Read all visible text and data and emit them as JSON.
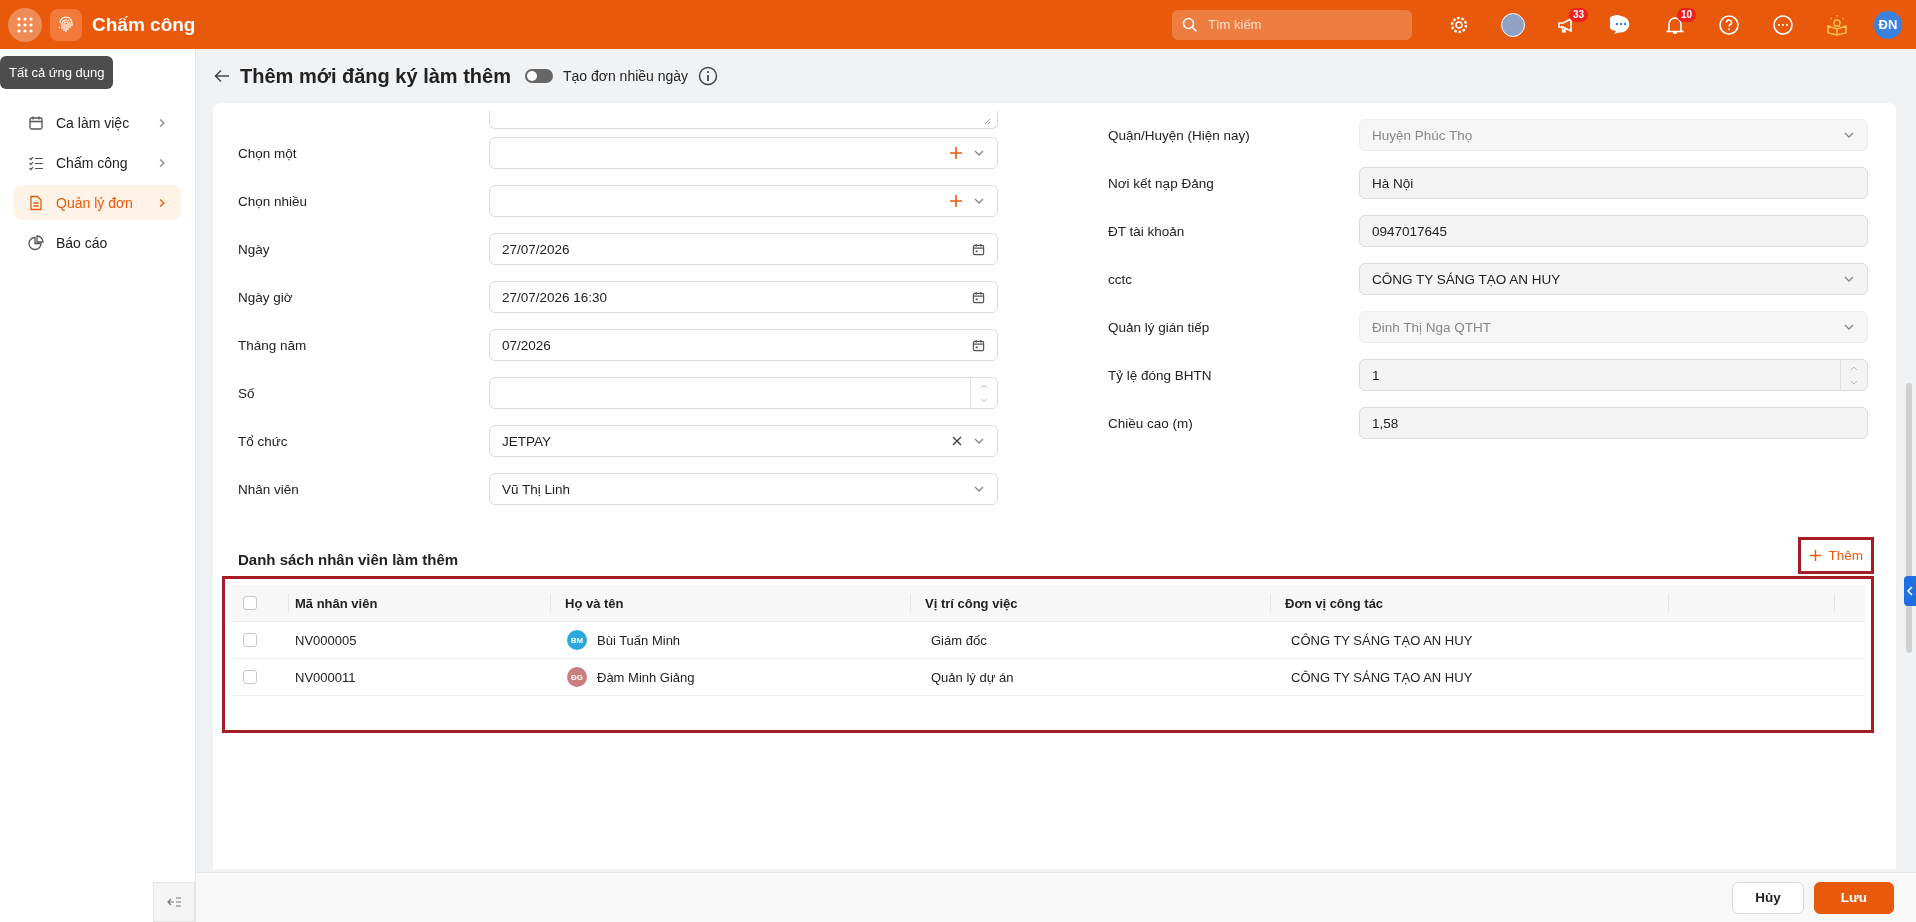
{
  "topbar": {
    "app_title": "Chấm công",
    "search": {
      "placeholder": "Tìm kiếm"
    },
    "badges": [
      {
        "kind": "megaphone",
        "count": "33"
      },
      {
        "kind": "bell",
        "count": "10"
      }
    ],
    "user_initials": "ĐN"
  },
  "tooltip": "Tất cả ứng dụng",
  "sidebar": {
    "items": [
      {
        "label": "Ca làm việc",
        "kind": "calendar",
        "selected": false,
        "has_children": true
      },
      {
        "label": "Chấm công",
        "kind": "checklist",
        "selected": false,
        "has_children": true
      },
      {
        "label": "Quản lý đơn",
        "kind": "document",
        "selected": true,
        "has_children": true
      },
      {
        "label": "Báo cáo",
        "kind": "pie",
        "selected": false,
        "has_children": false
      }
    ]
  },
  "header": {
    "title": "Thêm mới đăng ký làm thêm",
    "toggle": {
      "label": "Tạo đơn nhiều ngày",
      "on": false
    }
  },
  "form_left": [
    {
      "label": "Chọn một",
      "kind": "select-add"
    },
    {
      "label": "Chọn nhiều",
      "kind": "select-add"
    },
    {
      "label": "Ngày",
      "kind": "date",
      "value": "27/07/2026"
    },
    {
      "label": "Ngày giờ",
      "kind": "date",
      "value": "27/07/2026 16:30"
    },
    {
      "label": "Tháng năm",
      "kind": "date",
      "value": "07/2026"
    },
    {
      "label": "Số",
      "kind": "number"
    },
    {
      "label": "Tổ chức",
      "kind": "select-clear",
      "value": "JETPAY"
    },
    {
      "label": "Nhân viên",
      "kind": "select",
      "value": "Vũ Thị Linh"
    }
  ],
  "form_right": [
    {
      "label": "Quận/Huyện (Hiện nay)",
      "kind": "select",
      "value": "Huyện Phúc Thọ",
      "disabled": true
    },
    {
      "label": "Nơi kết nạp Đảng",
      "kind": "text",
      "value": "Hà Nội",
      "disabled": false
    },
    {
      "label": "ĐT tài khoản",
      "kind": "text",
      "value": "0947017645",
      "disabled": false
    },
    {
      "label": "cctc",
      "kind": "select",
      "value": "CÔNG TY SÁNG TẠO AN HUY",
      "disabled": false
    },
    {
      "label": "Quản lý gián tiếp",
      "kind": "select",
      "value": "Đinh Thị Nga QTHT",
      "disabled": true
    },
    {
      "label": "Tỷ lệ đóng BHTN",
      "kind": "number",
      "value": "1",
      "disabled": false
    },
    {
      "label": "Chiều cao (m)",
      "kind": "text",
      "value": "1,58",
      "disabled": false
    }
  ],
  "section": {
    "title": "Danh sách nhân viên làm thêm",
    "add_button": "Thêm"
  },
  "table": {
    "header_checked": false,
    "columns": [
      "Mã nhân viên",
      "Họ và tên",
      "Vị trí công việc",
      "Đơn vị công tác"
    ],
    "rows": [
      {
        "checked": false,
        "code": "NV000005",
        "initials": "BM",
        "color": "#29a8e0",
        "name": "Bùi Tuấn Minh",
        "position": "Giám đốc",
        "unit": "CÔNG TY SÁNG TẠO AN HUY"
      },
      {
        "checked": false,
        "code": "NV000011",
        "initials": "ĐG",
        "color": "#c97f7f",
        "name": "Đàm Minh Giảng",
        "position": "Quản lý dự án",
        "unit": "CÔNG TY SÁNG TẠO AN HUY"
      }
    ]
  },
  "footer": {
    "cancel": "Hủy",
    "save": "Lưu"
  }
}
